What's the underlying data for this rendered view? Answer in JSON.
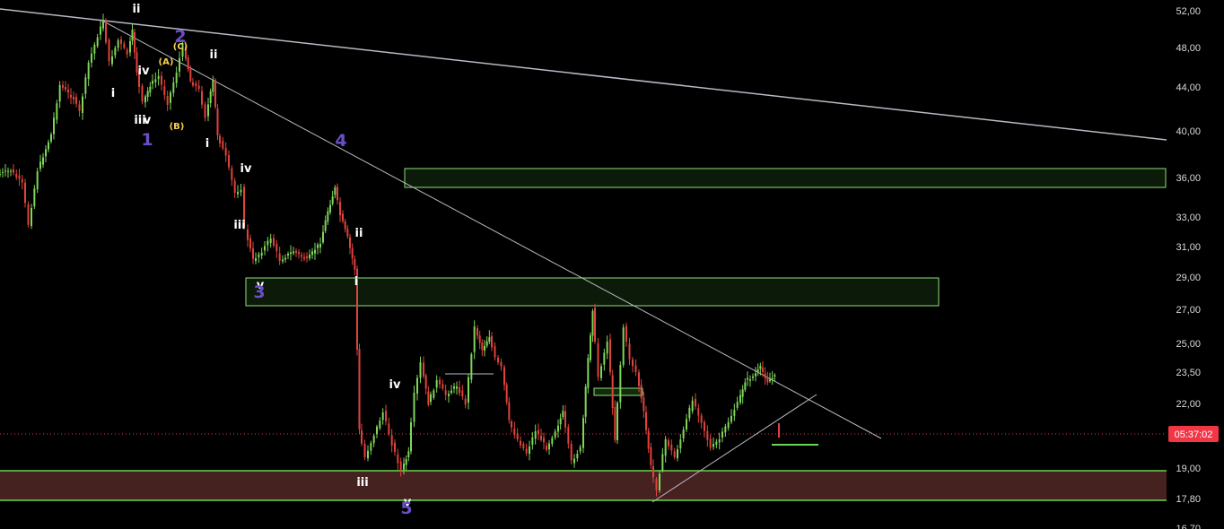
{
  "chart_data": {
    "type": "candlestick",
    "title": "",
    "xlabel": "",
    "ylabel": "",
    "y_axis_position": "right",
    "ylim": [
      16.2,
      52.6
    ],
    "grid": false,
    "y_ticks": [
      "52,00",
      "48,00",
      "44,00",
      "40,00",
      "36,00",
      "33,00",
      "31,00",
      "29,00",
      "27,00",
      "25,00",
      "23,50",
      "22,00",
      "19,00",
      "17,80",
      "16,70"
    ],
    "current_price_tag": "05:37:02",
    "current_price_value": 20.6,
    "colors": {
      "background": "#000000",
      "up_candle": "#7fd65b",
      "down_candle": "#e0433b",
      "trendline": "#b9b9c6",
      "zone_fill": "rgba(52,120,40,0.22)",
      "zone_border": "#8ee07a",
      "support_band_fill": "#45211f",
      "support_band_border": "#6bd64f",
      "price_tag": "#f23645",
      "wave_primary": "#6a4fc6",
      "wave_intermediate": "#f3d14a",
      "wave_minor": "#ffffff"
    },
    "zones": [
      {
        "name": "upper-resistance-zone",
        "low": 35.5,
        "high": 36.8
      },
      {
        "name": "middle-resistance-zone",
        "low": 27.5,
        "high": 29.1
      },
      {
        "name": "support-band",
        "low": 17.8,
        "high": 19.0
      },
      {
        "name": "small-zone-1",
        "low": 22.5,
        "high": 22.8
      },
      {
        "name": "small-zone-2",
        "low": 20.1,
        "high": 20.2
      }
    ],
    "wave_labels": [
      {
        "text": "ii",
        "style": "minor"
      },
      {
        "text": "2",
        "style": "primary"
      },
      {
        "text": "(C)",
        "style": "intermediate"
      },
      {
        "text": "(A)",
        "style": "intermediate"
      },
      {
        "text": "ii",
        "style": "minor"
      },
      {
        "text": "iv",
        "style": "minor"
      },
      {
        "text": "i",
        "style": "minor"
      },
      {
        "text": "iii",
        "style": "minor"
      },
      {
        "text": "v",
        "style": "minor"
      },
      {
        "text": "1",
        "style": "primary"
      },
      {
        "text": "(B)",
        "style": "intermediate"
      },
      {
        "text": "i",
        "style": "minor"
      },
      {
        "text": "iv",
        "style": "minor"
      },
      {
        "text": "4",
        "style": "primary"
      },
      {
        "text": "iii",
        "style": "minor"
      },
      {
        "text": "ii",
        "style": "minor"
      },
      {
        "text": "v",
        "style": "minor"
      },
      {
        "text": "3",
        "style": "primary"
      },
      {
        "text": "i",
        "style": "minor"
      },
      {
        "text": "iv",
        "style": "minor"
      },
      {
        "text": "iii",
        "style": "minor"
      },
      {
        "text": "v",
        "style": "minor"
      },
      {
        "text": "5",
        "style": "primary"
      }
    ]
  }
}
